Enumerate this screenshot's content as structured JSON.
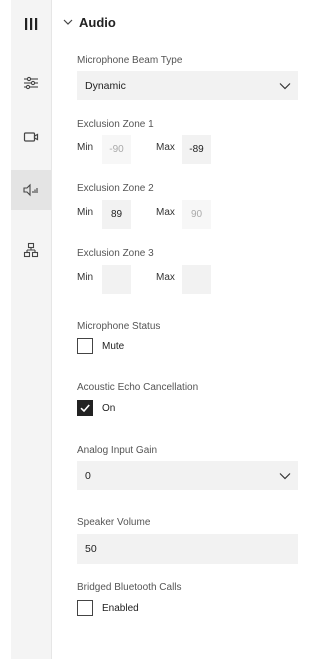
{
  "rail": {
    "items": [
      {
        "icon": "menu-bars-icon"
      },
      {
        "icon": "sliders-icon"
      },
      {
        "icon": "camera-icon"
      },
      {
        "icon": "speaker-icon"
      },
      {
        "icon": "network-icon"
      }
    ]
  },
  "section": {
    "title": "Audio"
  },
  "beam": {
    "label": "Microphone Beam Type",
    "value": "Dynamic"
  },
  "zone1": {
    "label": "Exclusion Zone 1",
    "min_label": "Min",
    "min_value": "-90",
    "max_label": "Max",
    "max_value": "-89"
  },
  "zone2": {
    "label": "Exclusion Zone 2",
    "min_label": "Min",
    "min_value": "89",
    "max_label": "Max",
    "max_value": "90"
  },
  "zone3": {
    "label": "Exclusion Zone 3",
    "min_label": "Min",
    "min_value": "",
    "max_label": "Max",
    "max_value": ""
  },
  "mic_status": {
    "label": "Microphone Status",
    "option": "Mute",
    "checked": false
  },
  "aec": {
    "label": "Acoustic Echo Cancellation",
    "option": "On",
    "checked": true
  },
  "gain": {
    "label": "Analog Input Gain",
    "value": "0"
  },
  "speaker": {
    "label": "Speaker Volume",
    "value": "50"
  },
  "bt": {
    "label": "Bridged Bluetooth Calls",
    "option": "Enabled",
    "checked": false
  }
}
